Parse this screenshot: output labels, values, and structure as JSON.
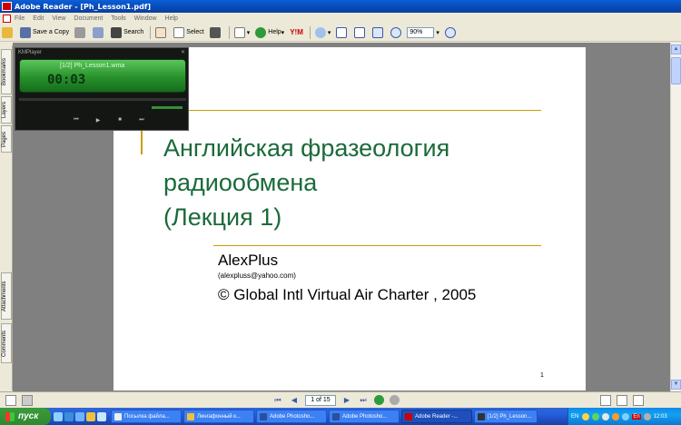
{
  "window": {
    "title": "Adobe Reader - [Ph_Lesson1.pdf]"
  },
  "menu": [
    "File",
    "Edit",
    "View",
    "Document",
    "Tools",
    "Window",
    "Help"
  ],
  "toolbar": {
    "save_copy": "Save a Copy",
    "search": "Search",
    "select": "Select",
    "help": "Help",
    "zoom": "90%"
  },
  "sidetabs": [
    "Bookmarks",
    "Layers",
    "Pages",
    "Attachments",
    "Comments"
  ],
  "page": {
    "title_line1": "Английская фразеология",
    "title_line2": "радиообмена",
    "title_line3": "(Лекция 1)",
    "author": "AlexPlus",
    "email": "(alexpluss@yahoo.com)",
    "copyright": "© Global Intl Virtual Air Charter , 2005",
    "page_number": "1"
  },
  "navigation": {
    "page_field": "1 of 15"
  },
  "kmplayer": {
    "title": "KMPlayer",
    "track": "[1/2] Ph_Lesson1.wma",
    "time": "00:03"
  },
  "taskbar": {
    "start": "пуск",
    "tasks": [
      "Посылка файла...",
      "Лингафонный к...",
      "Adobe Photosho...",
      "Adobe Photosho...",
      "Adobe Reader -...",
      "[1/2] Ph_Lesson..."
    ],
    "tray_lang": "EN",
    "tray_lang2": "En",
    "clock": "12:03"
  }
}
